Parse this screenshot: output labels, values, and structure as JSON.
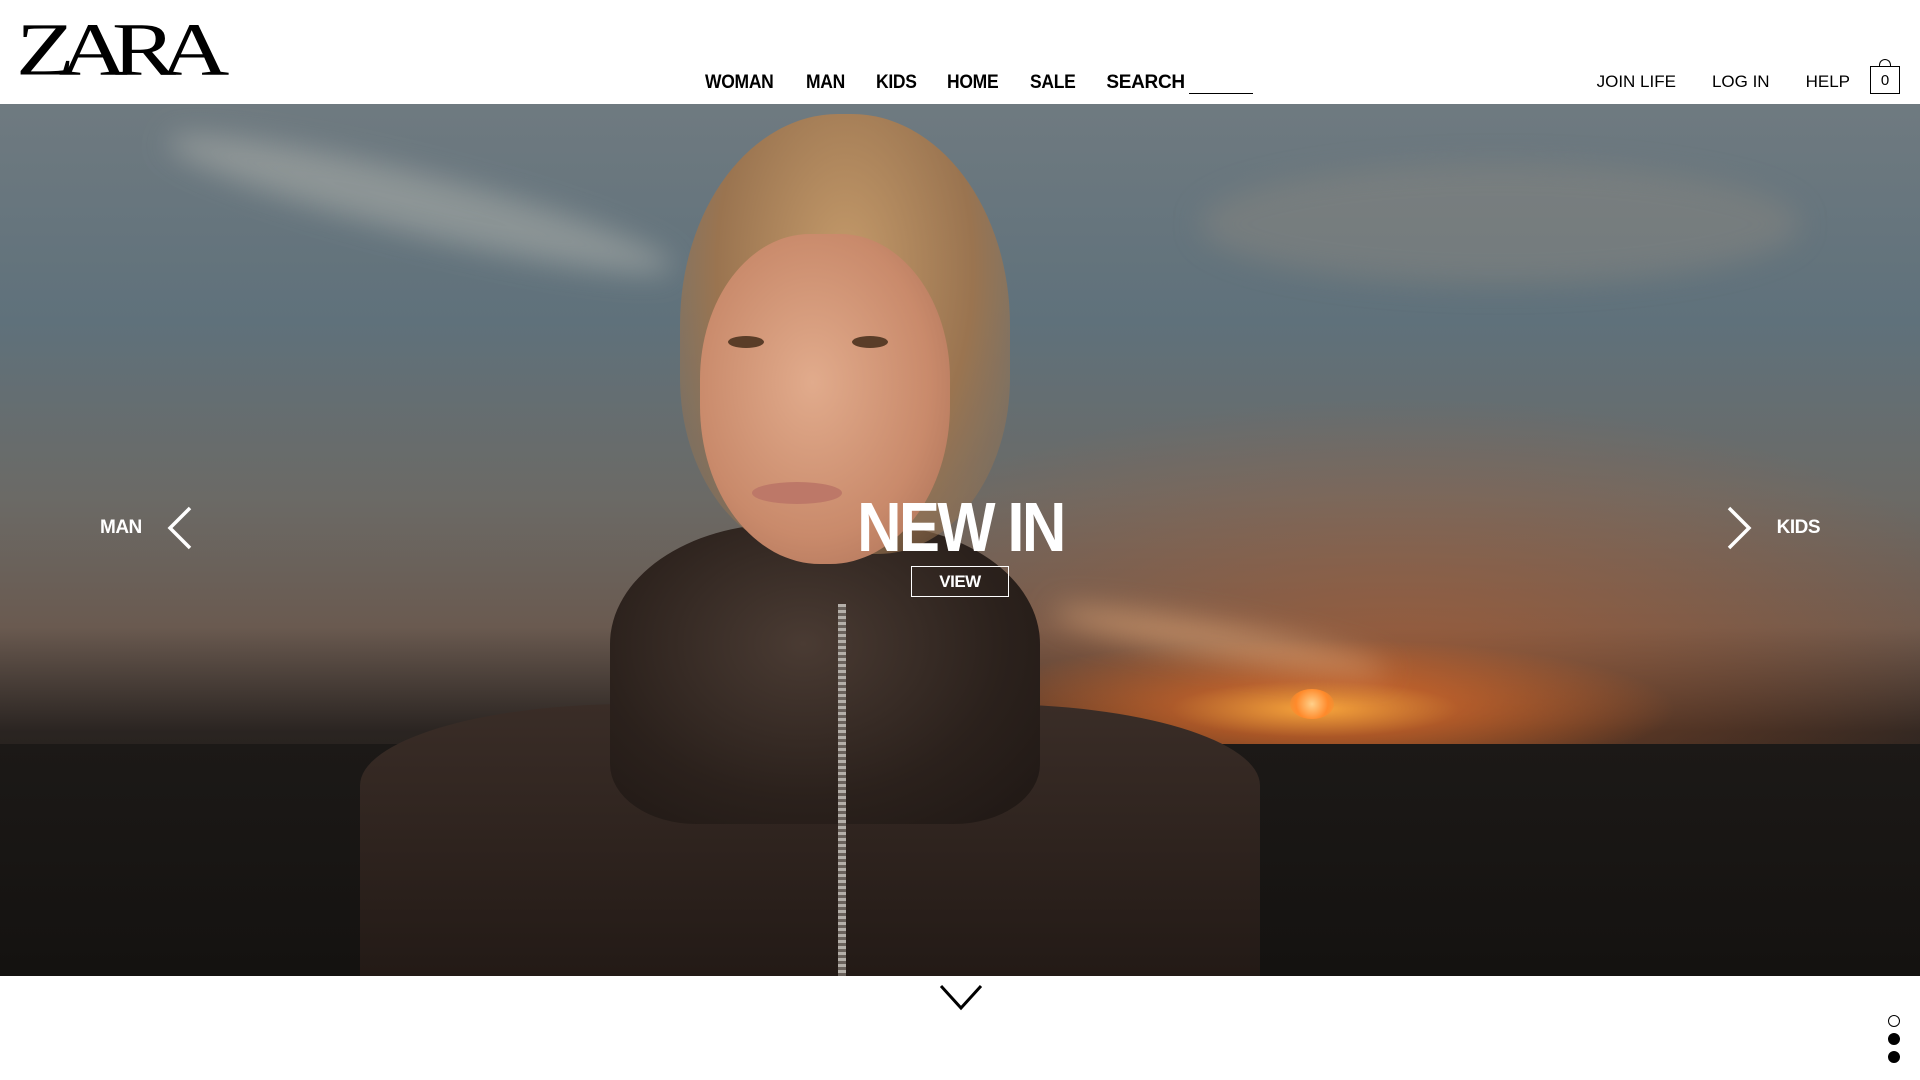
{
  "brand": {
    "logo_text": "ZARA"
  },
  "main_nav": {
    "items": [
      {
        "label": "WOMAN"
      },
      {
        "label": "MAN"
      },
      {
        "label": "KIDS"
      },
      {
        "label": "HOME"
      },
      {
        "label": "SALE"
      }
    ],
    "search_label": "SEARCH",
    "search_value": ""
  },
  "account_nav": {
    "items": [
      {
        "label": "JOIN LIFE"
      },
      {
        "label": "LOG IN"
      },
      {
        "label": "HELP"
      }
    ],
    "cart_count": "0",
    "cart_icon": "shopping-bag-icon"
  },
  "hero": {
    "prev_label": "MAN",
    "prev_icon": "chevron-left-icon",
    "next_label": "KIDS",
    "next_icon": "chevron-right-icon",
    "title": "NEW IN",
    "cta_label": "VIEW"
  },
  "scroll_icon": "chevron-down-icon",
  "slide_dots": {
    "count": 3,
    "active_index": 0
  },
  "colors": {
    "text": "#000000",
    "hero_text": "#ffffff",
    "background": "#ffffff"
  }
}
